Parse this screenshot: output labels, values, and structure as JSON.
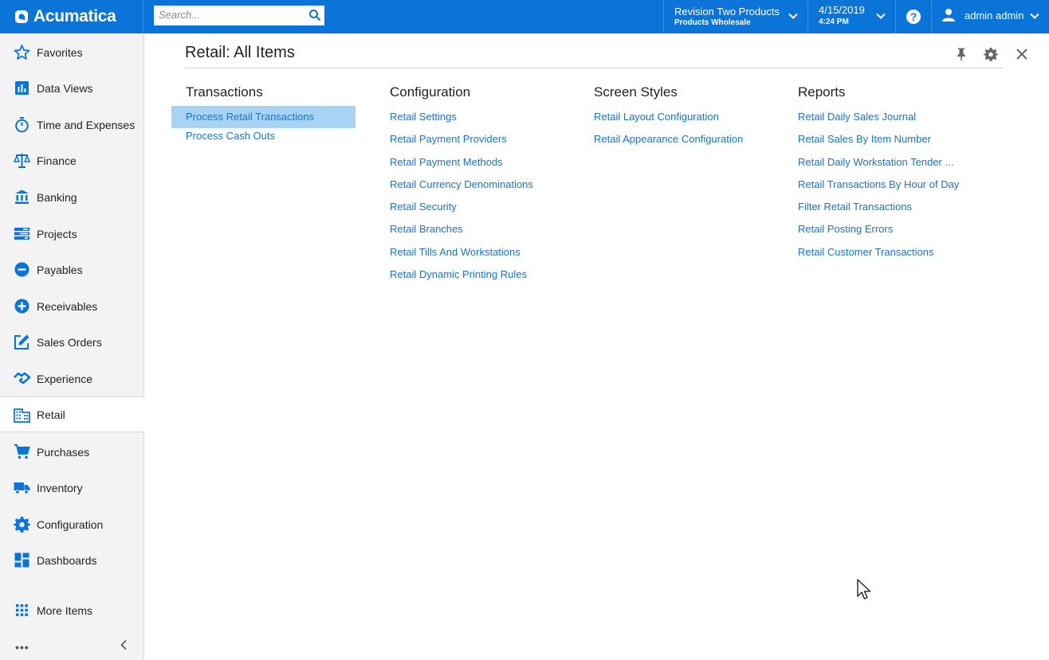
{
  "topbar": {
    "brand": "Acumatica",
    "search_placeholder": "Search...",
    "company_line1": "Revision Two Products",
    "company_line2": "Products Wholesale",
    "date": "4/15/2019",
    "time": "4:24 PM",
    "help": "?",
    "user": "admin admin"
  },
  "sidebar": {
    "items": [
      {
        "label": "Favorites",
        "icon": "star-icon"
      },
      {
        "label": "Data Views",
        "icon": "bar-chart-icon"
      },
      {
        "label": "Time and Expenses",
        "icon": "stopwatch-icon"
      },
      {
        "label": "Finance",
        "icon": "scales-icon"
      },
      {
        "label": "Banking",
        "icon": "bank-icon"
      },
      {
        "label": "Projects",
        "icon": "projects-icon"
      },
      {
        "label": "Payables",
        "icon": "minus-circle-icon"
      },
      {
        "label": "Receivables",
        "icon": "plus-circle-icon"
      },
      {
        "label": "Sales Orders",
        "icon": "edit-icon"
      },
      {
        "label": "Experience",
        "icon": "handshake-icon"
      },
      {
        "label": "Retail",
        "icon": "building-icon"
      },
      {
        "label": "Purchases",
        "icon": "cart-icon"
      },
      {
        "label": "Inventory",
        "icon": "truck-icon"
      },
      {
        "label": "Configuration",
        "icon": "gear-icon"
      },
      {
        "label": "Dashboards",
        "icon": "dashboard-icon"
      },
      {
        "label": "More Items",
        "icon": "grid-icon"
      }
    ],
    "active": "Retail",
    "dots": "•••"
  },
  "main": {
    "title": "Retail: All Items",
    "columns": [
      {
        "heading": "Transactions",
        "links": [
          "Process Retail Transactions",
          "Process Cash Outs"
        ]
      },
      {
        "heading": "Configuration",
        "links": [
          "Retail Settings",
          "Retail Payment Providers",
          "Retail Payment Methods",
          "Retail Currency Denominations",
          "Retail Security",
          "Retail Branches",
          "Retail Tills And Workstations",
          "Retail Dynamic Printing Rules"
        ]
      },
      {
        "heading": "Screen Styles",
        "links": [
          "Retail Layout Configuration",
          "Retail Appearance Configuration"
        ]
      },
      {
        "heading": "Reports",
        "links": [
          "Retail Daily Sales Journal",
          "Retail Sales By Item Number",
          "Retail Daily Workstation Tender ...",
          "Retail Transactions By Hour of Day",
          "Filter Retail Transactions",
          "Retail Posting Errors",
          "Retail Customer Transactions"
        ]
      }
    ],
    "selected_link": "Process Retail Transactions"
  },
  "colors": {
    "accent": "#0a74d9",
    "link": "#1a73c9",
    "selected_bg": "#a9d3f4"
  }
}
